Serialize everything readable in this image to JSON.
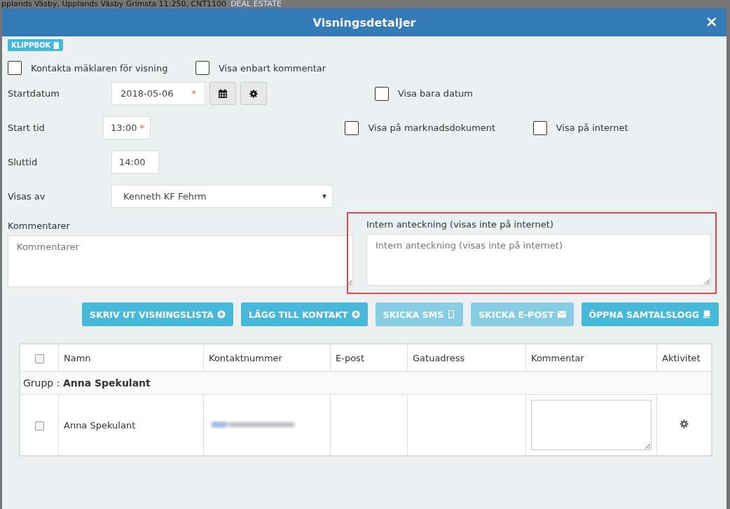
{
  "background_text": {
    "address": "pplands Väsby, Upplands Väsby Grimsta 11:250, CNT1100",
    "agency": "DEAL ESTATE"
  },
  "window": {
    "title": "Visningsdetaljer",
    "close": "×"
  },
  "clipbook_button": {
    "label": "KLIPPBOK"
  },
  "top_checkboxes": [
    {
      "label": "Kontakta mäklaren för visning",
      "checked": false
    },
    {
      "label": "Visa enbart kommentar",
      "checked": false
    }
  ],
  "form_rows": [
    {
      "label": "Startdatum",
      "field": {
        "kind": "date",
        "value": "2018-05-06",
        "required_mark": "*"
      },
      "checkboxes": [
        {
          "label": "Visa bara datum",
          "checked": false
        }
      ]
    },
    {
      "label": "Start tid",
      "field": {
        "kind": "time",
        "value": "13:00",
        "required_mark": "*"
      },
      "checkboxes": [
        {
          "label": "Visa på marknadsdokument",
          "checked": false
        },
        {
          "label": "Visa på internet",
          "checked": false
        }
      ]
    },
    {
      "label": "Sluttid",
      "field": {
        "kind": "time",
        "value": "14:00"
      }
    },
    {
      "label": "Visas av",
      "field": {
        "kind": "select",
        "value": "Kenneth KF Fehrm"
      }
    }
  ],
  "notes": [
    {
      "label": "Kommentarer",
      "placeholder": "Kommentarer",
      "highlighted": false
    },
    {
      "label": "Intern anteckning (visas inte på internet)",
      "placeholder": "Intern anteckning (visas inte på internet)",
      "highlighted": true
    }
  ],
  "actions": [
    {
      "label": "SKRIV UT VISNINGSLISTA",
      "kind": "add",
      "disabled": false
    },
    {
      "label": "LÄGG TILL KONTAKT",
      "kind": "add",
      "disabled": false
    },
    {
      "label": "SKICKA SMS",
      "kind": "sms",
      "disabled": true
    },
    {
      "label": "SKICKA E-POST",
      "kind": "email",
      "disabled": true
    },
    {
      "label": "ÖPPNA SAMTALSLOGG",
      "kind": "log",
      "disabled": false
    }
  ],
  "table": {
    "header_checked": false,
    "columns": [
      "Namn",
      "Kontaktnummer",
      "E-post",
      "Gatuadress",
      "Kommentar",
      "Aktivitet"
    ],
    "group": {
      "prefix": "Grupp :",
      "name": "Anna Spekulant"
    },
    "rows": [
      {
        "checked": false,
        "name": "Anna Spekulant"
      }
    ]
  }
}
